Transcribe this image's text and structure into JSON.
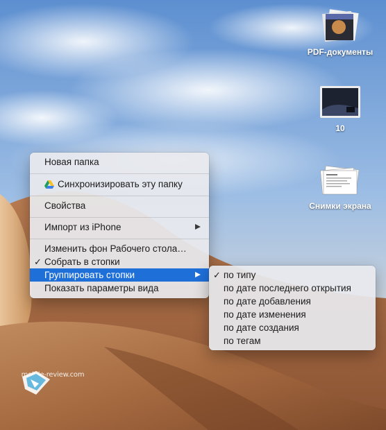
{
  "desktop": {
    "stacks": [
      {
        "label": "PDF-документы",
        "icon": "pdf-stack-icon"
      },
      {
        "label": "10",
        "icon": "movie-stack-icon"
      },
      {
        "label": "Снимки экрана",
        "icon": "screenshot-stack-icon"
      }
    ]
  },
  "context_menu": {
    "items": [
      {
        "label": "Новая папка"
      },
      {
        "label": "Синхронизировать эту папку",
        "icon": "google-drive-icon"
      },
      {
        "label": "Свойства"
      },
      {
        "label": "Импорт из iPhone",
        "has_submenu": true
      },
      {
        "label": "Изменить фон Рабочего стола…"
      },
      {
        "label": "Собрать в стопки",
        "checked": true
      },
      {
        "label": "Группировать стопки",
        "has_submenu": true,
        "highlighted": true
      },
      {
        "label": "Показать параметры вида"
      }
    ],
    "checkmark": "✓"
  },
  "submenu": {
    "items": [
      {
        "label": "по типу",
        "checked": true
      },
      {
        "label": "по дате последнего открытия"
      },
      {
        "label": "по дате добавления"
      },
      {
        "label": "по дате изменения"
      },
      {
        "label": "по дате создания"
      },
      {
        "label": "по тегам"
      }
    ]
  },
  "watermark": {
    "text": "mobile-review.com"
  },
  "colors": {
    "highlight": "#1f6fd9",
    "sky": "#6f9ed8",
    "dune": "#a86b42"
  }
}
